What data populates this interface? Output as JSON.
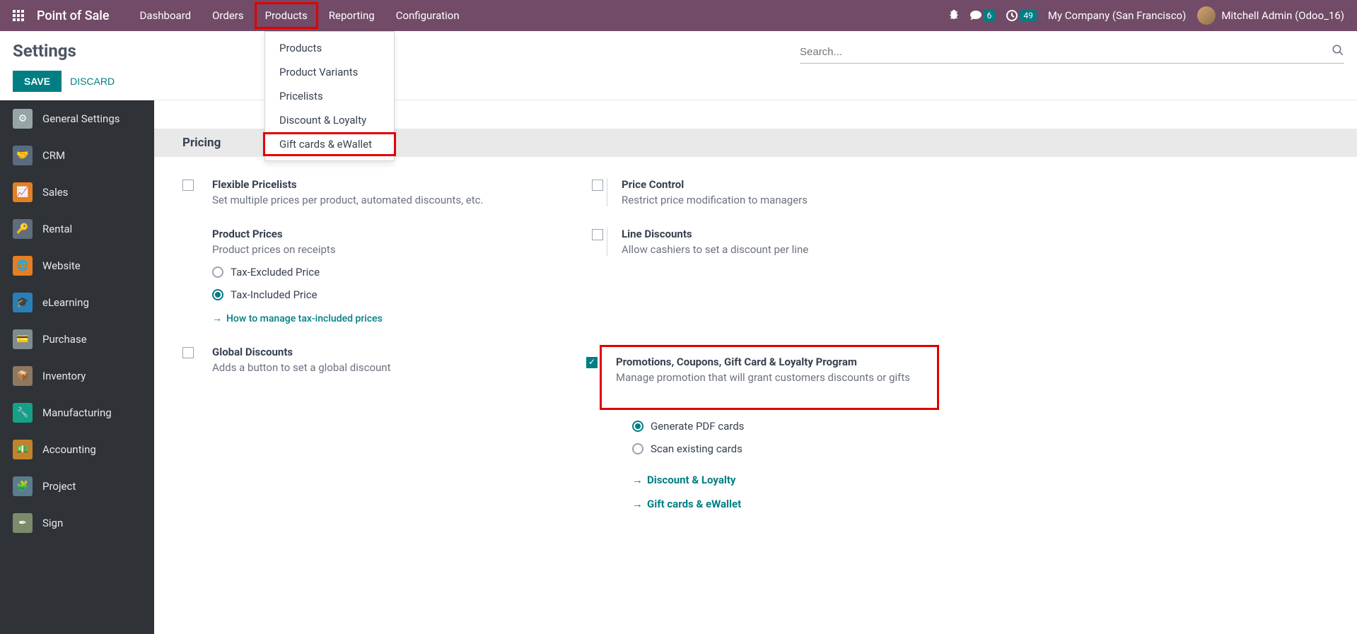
{
  "navbar": {
    "brand": "Point of Sale",
    "links": [
      "Dashboard",
      "Orders",
      "Products",
      "Reporting",
      "Configuration"
    ],
    "msg_count": "6",
    "clock_count": "49",
    "company": "My Company (San Francisco)",
    "user": "Mitchell Admin (Odoo_16)"
  },
  "control": {
    "title": "Settings",
    "save": "SAVE",
    "discard": "DISCARD",
    "search_placeholder": "Search..."
  },
  "sidebar": {
    "items": [
      {
        "label": "General Settings"
      },
      {
        "label": "CRM"
      },
      {
        "label": "Sales"
      },
      {
        "label": "Rental"
      },
      {
        "label": "Website"
      },
      {
        "label": "eLearning"
      },
      {
        "label": "Purchase"
      },
      {
        "label": "Inventory"
      },
      {
        "label": "Manufacturing"
      },
      {
        "label": "Accounting"
      },
      {
        "label": "Project"
      },
      {
        "label": "Sign"
      }
    ]
  },
  "section": {
    "pricing": "Pricing"
  },
  "settings": {
    "flexible_title": "Flexible Pricelists",
    "flexible_desc": "Set multiple prices per product, automated discounts, etc.",
    "product_prices_title": "Product Prices",
    "product_prices_desc": "Product prices on receipts",
    "radio_excl": "Tax-Excluded Price",
    "radio_incl": "Tax-Included Price",
    "tax_help": "How to manage tax-included prices",
    "global_title": "Global Discounts",
    "global_desc": "Adds a button to set a global discount",
    "price_control_title": "Price Control",
    "price_control_desc": "Restrict price modification to managers",
    "line_disc_title": "Line Discounts",
    "line_disc_desc": "Allow cashiers to set a discount per line",
    "promo_title": "Promotions, Coupons, Gift Card & Loyalty Program",
    "promo_desc": "Manage promotion that will grant customers discounts or gifts",
    "gen_pdf": "Generate PDF cards",
    "scan_cards": "Scan existing cards",
    "disc_loyalty": "Discount & Loyalty",
    "giftcards": "Gift cards & eWallet"
  },
  "dropdown": {
    "items": [
      "Products",
      "Product Variants",
      "Pricelists",
      "Discount & Loyalty",
      "Gift cards & eWallet"
    ]
  }
}
